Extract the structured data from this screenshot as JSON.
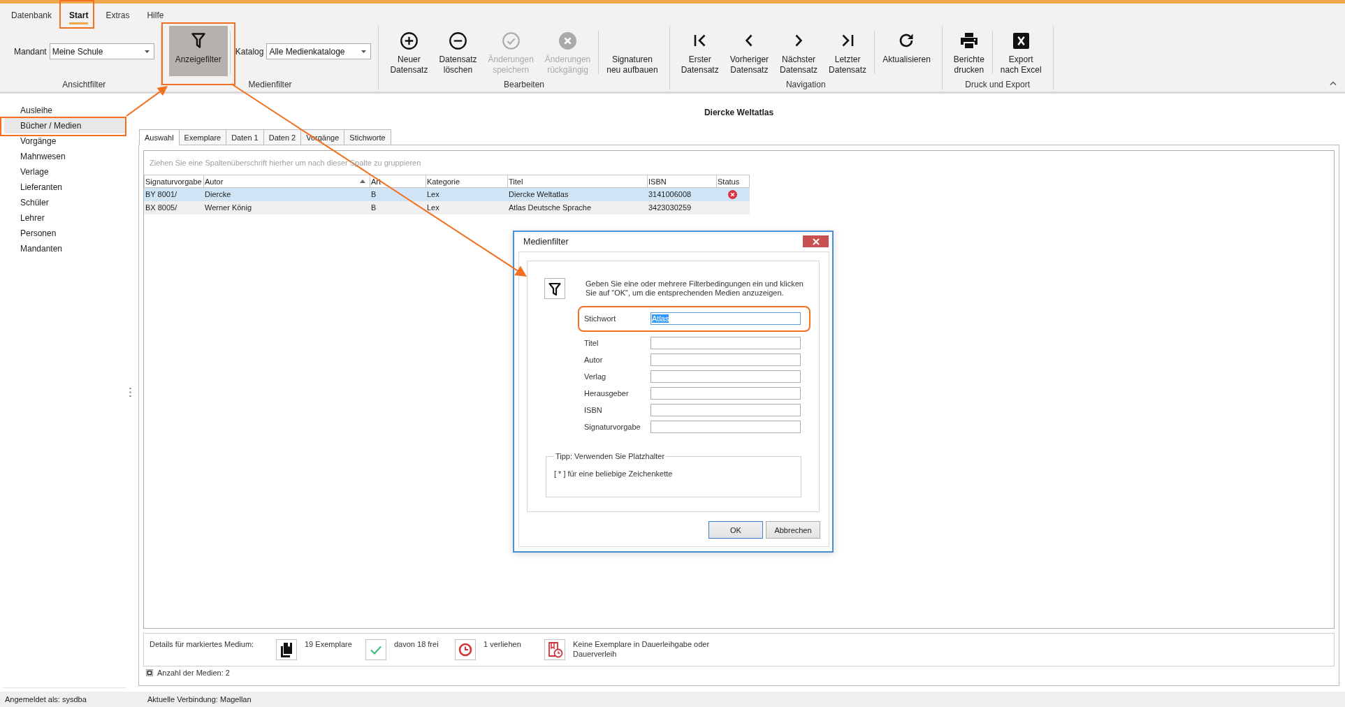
{
  "menu_tabs": [
    {
      "label": "Datenbank",
      "selected": false,
      "highlighted": false
    },
    {
      "label": "Start",
      "selected": true,
      "highlighted": true
    },
    {
      "label": "Extras",
      "selected": false,
      "highlighted": false
    },
    {
      "label": "Hilfe",
      "selected": false,
      "highlighted": false
    }
  ],
  "ribbon": {
    "groups": [
      {
        "label": "Ansichtfilter",
        "sections": [
          {
            "items": [
              {
                "kind": "combo",
                "label": "Mandant",
                "value": "Meine Schule"
              }
            ]
          }
        ]
      },
      {
        "label": "Medienfilter",
        "sections": [
          {
            "items": [
              {
                "kind": "large_button",
                "label": "Anzeigefilter",
                "pressed": true,
                "disabled": false,
                "highlighted": true
              }
            ]
          },
          {
            "items": [
              {
                "kind": "combo",
                "label": "Katalog",
                "value": "Alle Medienkataloge"
              }
            ]
          }
        ]
      },
      {
        "label": "Bearbeiten",
        "sections": [
          {
            "items": [
              {
                "kind": "large_button",
                "label": "Neuer Datensatz",
                "pressed": false,
                "disabled": false,
                "highlighted": false
              },
              {
                "kind": "large_button",
                "label": "Datensatz löschen",
                "pressed": false,
                "disabled": false,
                "highlighted": false
              },
              {
                "kind": "large_button",
                "label": "Änderungen speichern",
                "pressed": false,
                "disabled": true,
                "highlighted": false
              },
              {
                "kind": "large_button",
                "label": "Änderungen rückgängig",
                "pressed": false,
                "disabled": true,
                "highlighted": false
              }
            ]
          },
          {
            "items": [
              {
                "kind": "large_button",
                "label": "Signaturen neu aufbauen",
                "pressed": false,
                "disabled": false,
                "highlighted": false
              }
            ]
          }
        ]
      },
      {
        "label": "Navigation",
        "sections": [
          {
            "items": [
              {
                "kind": "large_button",
                "label": "Erster Datensatz",
                "pressed": false,
                "disabled": false,
                "highlighted": false
              },
              {
                "kind": "large_button",
                "label": "Vorheriger Datensatz",
                "pressed": false,
                "disabled": false,
                "highlighted": false
              },
              {
                "kind": "large_button",
                "label": "Nächster Datensatz",
                "pressed": false,
                "disabled": false,
                "highlighted": false
              },
              {
                "kind": "large_button",
                "label": "Letzter Datensatz",
                "pressed": false,
                "disabled": false,
                "highlighted": false
              }
            ]
          },
          {
            "items": [
              {
                "kind": "large_button",
                "label": "Aktualisieren",
                "pressed": false,
                "disabled": false,
                "highlighted": false
              }
            ]
          }
        ]
      },
      {
        "label": "Druck und Export",
        "sections": [
          {
            "items": [
              {
                "kind": "large_button",
                "label": "Berichte drucken",
                "pressed": false,
                "disabled": false,
                "highlighted": false
              }
            ]
          },
          {
            "items": [
              {
                "kind": "large_button",
                "label": "Export nach Excel",
                "pressed": false,
                "disabled": false,
                "highlighted": false
              }
            ]
          }
        ]
      }
    ]
  },
  "nav_items": [
    {
      "label": "Ausleihe",
      "selected": false,
      "highlighted": false
    },
    {
      "label": "Bücher / Medien",
      "selected": true,
      "highlighted": true
    },
    {
      "label": "Vorgänge",
      "selected": false,
      "highlighted": false
    },
    {
      "label": "Mahnwesen",
      "selected": false,
      "highlighted": false
    },
    {
      "label": "Verlage",
      "selected": false,
      "highlighted": false
    },
    {
      "label": "Lieferanten",
      "selected": false,
      "highlighted": false
    },
    {
      "label": "Schüler",
      "selected": false,
      "highlighted": false
    },
    {
      "label": "Lehrer",
      "selected": false,
      "highlighted": false
    },
    {
      "label": "Personen",
      "selected": false,
      "highlighted": false
    },
    {
      "label": "Mandanten",
      "selected": false,
      "highlighted": false
    }
  ],
  "record_title": "Diercke Weltatlas",
  "detail_tabs": [
    {
      "label": "Auswahl",
      "selected": true
    },
    {
      "label": "Exemplare",
      "selected": false
    },
    {
      "label": "Daten 1",
      "selected": false
    },
    {
      "label": "Daten 2",
      "selected": false
    },
    {
      "label": "Vorgänge",
      "selected": false
    },
    {
      "label": "Stichworte",
      "selected": false
    }
  ],
  "grid": {
    "group_hint": "Ziehen Sie eine Spaltenüberschrift hierher um nach dieser Spalte zu gruppieren",
    "columns": [
      {
        "label": "Signaturvorgabe",
        "sorted": false
      },
      {
        "label": "Autor",
        "sorted": true
      },
      {
        "label": "Art",
        "sorted": false
      },
      {
        "label": "Kategorie",
        "sorted": false
      },
      {
        "label": "Titel",
        "sorted": false
      },
      {
        "label": "ISBN",
        "sorted": false
      },
      {
        "label": "Status",
        "sorted": false
      }
    ],
    "rows": [
      {
        "cells": [
          "BY 8001/",
          "Diercke",
          "B",
          "Lex",
          "Diercke Weltatlas",
          "3141006008"
        ],
        "flagged": true,
        "selected": true
      },
      {
        "cells": [
          "BX 8005/",
          "Werner König",
          "B",
          "Lex",
          "Atlas Deutsche Sprache",
          "3423030259"
        ],
        "flagged": false,
        "selected": false
      }
    ]
  },
  "details": {
    "label": "Details für markiertes Medium:",
    "items": [
      {
        "text": "19 Exemplare"
      },
      {
        "text": "davon 18 frei"
      },
      {
        "text": "1 verliehen"
      },
      {
        "text": "Keine Exemplare in Dauerleihgabe oder Dauerverleih"
      }
    ]
  },
  "record_count": "Anzahl der Medien: 2",
  "status_bar": [
    "Angemeldet als: sysdba",
    "Aktuelle Verbindung: Magellan"
  ],
  "dialog": {
    "title": "Medienfilter",
    "message": "Geben Sie eine oder mehrere Filterbedingungen ein und klicken Sie auf \"OK\", um die entsprechenden Medien anzuzeigen.",
    "fields": [
      {
        "label": "Stichwort",
        "value": "Atlas",
        "focused": true,
        "highlighted": true
      },
      {
        "label": "Titel",
        "focused": false,
        "highlighted": false
      },
      {
        "label": "Autor",
        "focused": false,
        "highlighted": false
      },
      {
        "label": "Verlag",
        "focused": false,
        "highlighted": false
      },
      {
        "label": "Herausgeber",
        "focused": false,
        "highlighted": false
      },
      {
        "label": "ISBN",
        "focused": false,
        "highlighted": false
      },
      {
        "label": "Signaturvorgabe",
        "focused": false,
        "highlighted": false
      }
    ],
    "tip": {
      "legend": "Tipp: Verwenden Sie Platzhalter",
      "text": "[ * ] für eine beliebige Zeichenkette"
    },
    "buttons": [
      {
        "label": "OK",
        "default": true
      },
      {
        "label": "Abbrechen",
        "default": false
      }
    ]
  }
}
